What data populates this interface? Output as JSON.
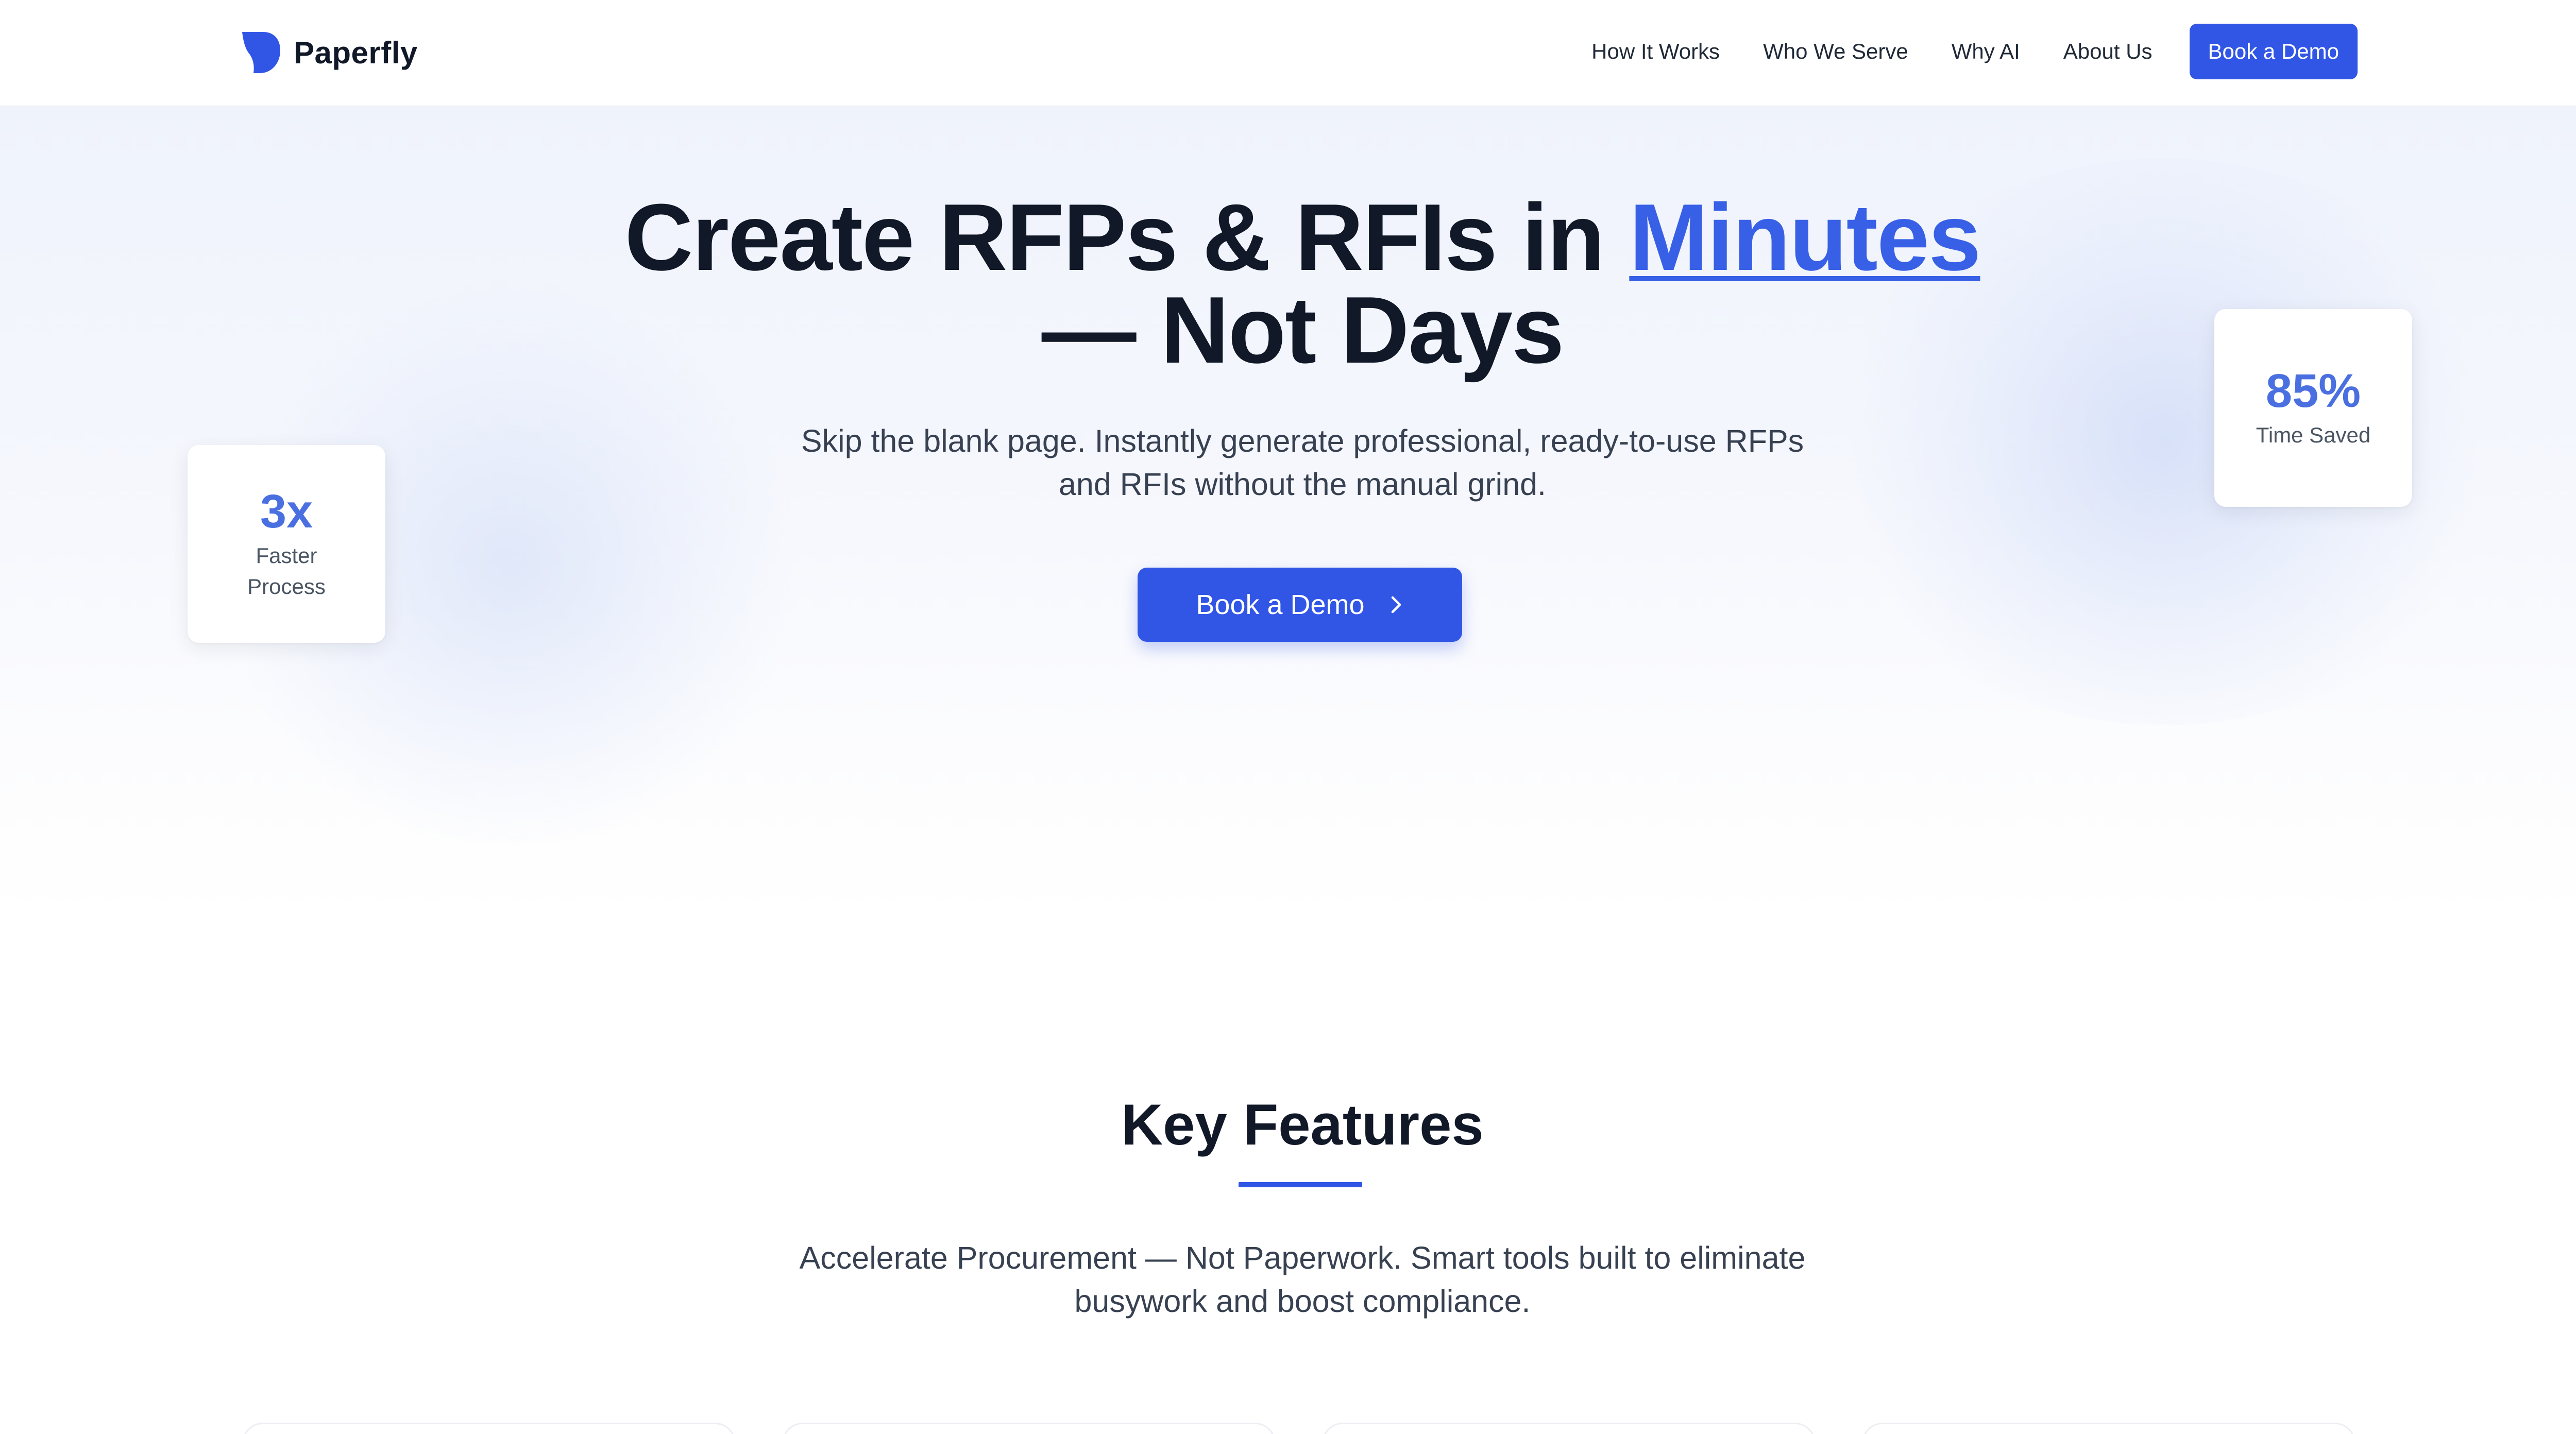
{
  "brand": {
    "name": "Paperfly",
    "accent": "#3156e6"
  },
  "nav": {
    "links": [
      "How It Works",
      "Who We Serve",
      "Why AI",
      "About Us"
    ],
    "cta": "Book a Demo"
  },
  "hero": {
    "headline_part1": "Create RFPs & RFIs in ",
    "headline_accent": "Minutes",
    "headline_part2": "— Not Days",
    "subhead": "Skip the blank page. Instantly generate professional, ready-to-use RFPs and RFIs without the manual grind.",
    "cta": "Book a Demo",
    "cta_icon": "chevron-right-icon",
    "stats": [
      {
        "value": "3x",
        "label": "Faster Process"
      },
      {
        "value": "85%",
        "label": "Time Saved"
      }
    ]
  },
  "features": {
    "title": "Key Features",
    "subtitle": "Accelerate Procurement — Not Paperwork. Smart tools built to eliminate busywork and boost compliance."
  }
}
